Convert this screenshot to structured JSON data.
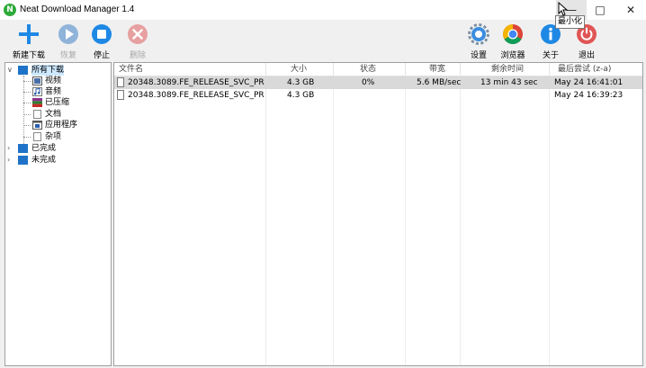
{
  "window": {
    "title": "Neat Download Manager 1.4",
    "tooltip": "最小化"
  },
  "toolbar": {
    "new_download": "新建下载",
    "resume": "恢复",
    "stop": "停止",
    "delete": "删除",
    "settings": "设置",
    "browser": "浏览器",
    "about": "关于",
    "exit": "退出"
  },
  "tree": {
    "all": "所有下载",
    "video": "视频",
    "audio": "音频",
    "compressed": "已压缩",
    "documents": "文档",
    "applications": "应用程序",
    "other": "杂项",
    "completed": "已完成",
    "incomplete": "未完成"
  },
  "columns": {
    "filename": "文件名",
    "size": "大小",
    "status": "状态",
    "speed": "带宽",
    "time_left": "剩余时间",
    "last_try": "最后尝试 (z-a)"
  },
  "rows": [
    {
      "filename": "20348.3089.FE_RELEASE_SVC_PR...",
      "size": "4.3 GB",
      "status": "0%",
      "speed": "5.6 MB/sec",
      "time_left": "13 min  43 sec",
      "last_try": "May 24 16:41:01"
    },
    {
      "filename": "20348.3089.FE_RELEASE_SVC_PR...",
      "size": "4.3 GB",
      "status": "",
      "speed": "",
      "time_left": "",
      "last_try": "May 24 16:39:23"
    }
  ],
  "colors": {
    "accent_blue": "#1e88e5",
    "folder_blue": "#1e73c8",
    "stop_red": "#e05555",
    "selected_row": "#d9d9d9",
    "app_green": "#2eaa3a"
  }
}
